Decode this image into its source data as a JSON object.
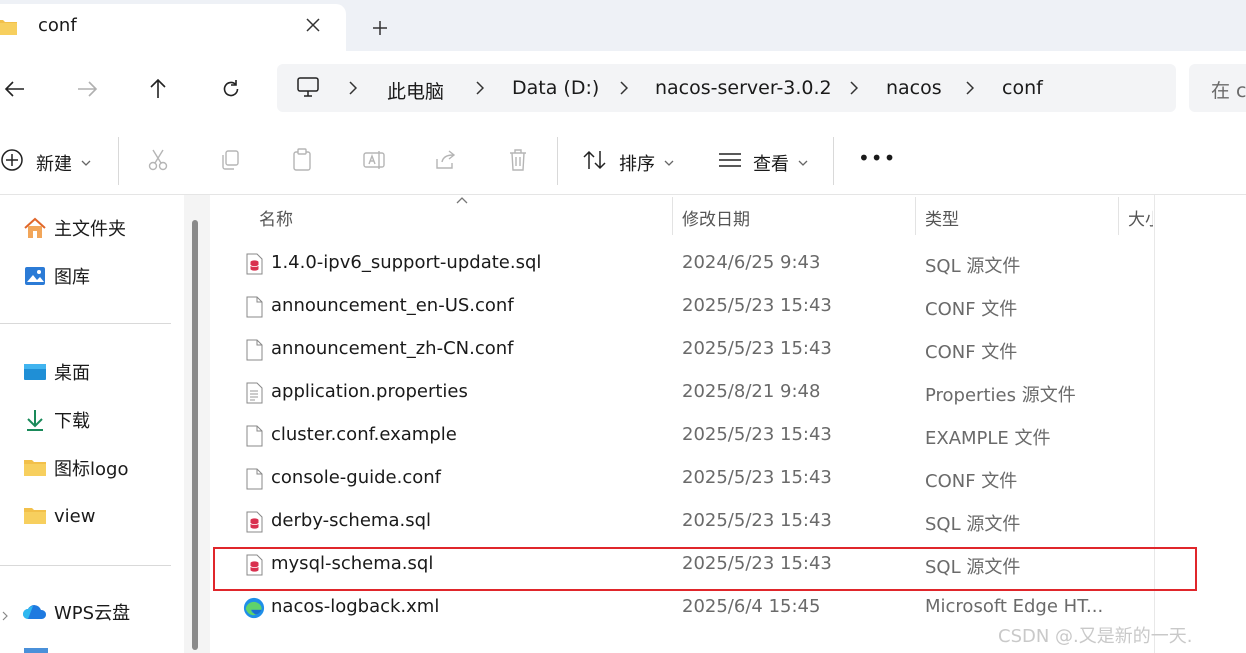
{
  "tab": {
    "title": "conf"
  },
  "address": {
    "crumbs": [
      "此电脑",
      "Data (D:)",
      "nacos-server-3.0.2",
      "nacos",
      "conf"
    ],
    "search_placeholder": "在 c"
  },
  "toolbar": {
    "new_label": "新建",
    "sort_label": "排序",
    "view_label": "查看",
    "more_label": "•••"
  },
  "sidebar": {
    "items": [
      {
        "label": "主文件夹",
        "icon": "home-icon"
      },
      {
        "label": "图库",
        "icon": "gallery-icon"
      },
      {
        "label": "桌面",
        "icon": "desktop-icon"
      },
      {
        "label": "下载",
        "icon": "download-icon"
      },
      {
        "label": "图标logo",
        "icon": "folder-icon"
      },
      {
        "label": "view",
        "icon": "folder-icon"
      },
      {
        "label": "WPS云盘",
        "icon": "cloud-icon"
      }
    ]
  },
  "columns": {
    "name": "名称",
    "modified": "修改日期",
    "type": "类型",
    "size": "大小"
  },
  "files": [
    {
      "name": "1.4.0-ipv6_support-update.sql",
      "date": "2024/6/25 9:43",
      "type": "SQL 源文件",
      "icon": "sql-file-icon"
    },
    {
      "name": "announcement_en-US.conf",
      "date": "2025/5/23 15:43",
      "type": "CONF 文件",
      "icon": "file-icon"
    },
    {
      "name": "announcement_zh-CN.conf",
      "date": "2025/5/23 15:43",
      "type": "CONF 文件",
      "icon": "file-icon"
    },
    {
      "name": "application.properties",
      "date": "2025/8/21 9:48",
      "type": "Properties 源文件",
      "icon": "text-file-icon"
    },
    {
      "name": "cluster.conf.example",
      "date": "2025/5/23 15:43",
      "type": "EXAMPLE 文件",
      "icon": "file-icon"
    },
    {
      "name": "console-guide.conf",
      "date": "2025/5/23 15:43",
      "type": "CONF 文件",
      "icon": "file-icon"
    },
    {
      "name": "derby-schema.sql",
      "date": "2025/5/23 15:43",
      "type": "SQL 源文件",
      "icon": "sql-file-icon"
    },
    {
      "name": "mysql-schema.sql",
      "date": "2025/5/23 15:43",
      "type": "SQL 源文件",
      "icon": "sql-file-icon"
    },
    {
      "name": "nacos-logback.xml",
      "date": "2025/6/4 15:45",
      "type": "Microsoft Edge HT...",
      "icon": "edge-icon"
    }
  ],
  "watermark": "CSDN @.又是新的一天.",
  "colors": {
    "highlight": "#e0262b",
    "sql_icon": "#d9304f",
    "accent": "#0a66c2"
  }
}
